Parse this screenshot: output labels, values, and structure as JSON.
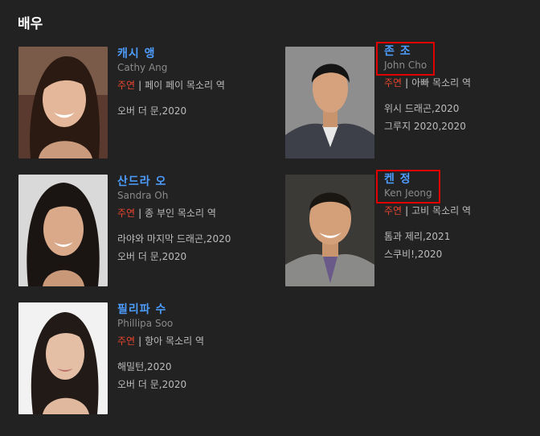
{
  "section": {
    "title": "배우"
  },
  "actors": [
    {
      "name_ko": "캐시 앵",
      "name_en": "Cathy Ang",
      "role_type": "주연",
      "role_desc": "페이 페이 목소리 역",
      "works": [
        "오버 더 문,2020"
      ]
    },
    {
      "name_ko": "존 조",
      "name_en": "John Cho",
      "role_type": "주연",
      "role_desc": "아빠 목소리 역",
      "works": [
        "위시 드래곤,2020",
        "그루지 2020,2020"
      ]
    },
    {
      "name_ko": "산드라 오",
      "name_en": "Sandra Oh",
      "role_type": "주연",
      "role_desc": "종 부인 목소리 역",
      "works": [
        "라야와 마지막 드래곤,2020",
        "오버 더 문,2020"
      ]
    },
    {
      "name_ko": "켄 정",
      "name_en": "Ken Jeong",
      "role_type": "주연",
      "role_desc": "고비 목소리 역",
      "works": [
        "톰과 제리,2021",
        "스쿠비!,2020"
      ]
    },
    {
      "name_ko": "필리파 수",
      "name_en": "Phillipa Soo",
      "role_type": "주연",
      "role_desc": "항아 목소리 역",
      "works": [
        "해밀턴,2020",
        "오버 더 문,2020"
      ]
    }
  ]
}
